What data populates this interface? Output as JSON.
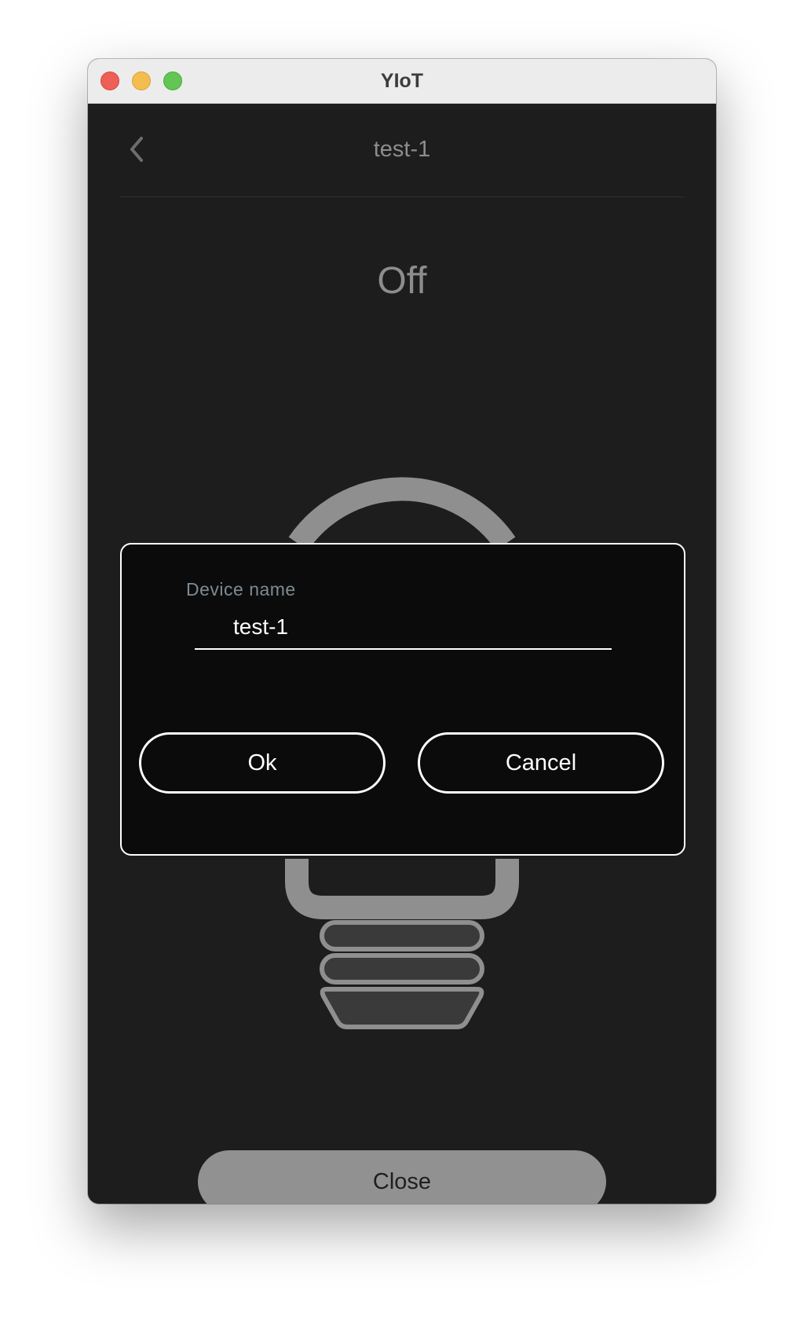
{
  "window": {
    "title": "YIoT"
  },
  "header": {
    "back_icon": "chevron-left-icon",
    "title": "test-1"
  },
  "device": {
    "state": "Off",
    "icon": "lightbulb-icon"
  },
  "dialog": {
    "field_label": "Device name",
    "field_value": "test-1",
    "ok_label": "Ok",
    "cancel_label": "Cancel"
  },
  "footer": {
    "close_label": "Close"
  },
  "colors": {
    "background": "#1d1d1d",
    "dialog_background": "#0b0b0b",
    "muted_text": "#8d8d8d",
    "close_button": "#919191",
    "traffic_red": "#ee5f57",
    "traffic_yellow": "#f5bd4f",
    "traffic_green": "#62c655"
  }
}
